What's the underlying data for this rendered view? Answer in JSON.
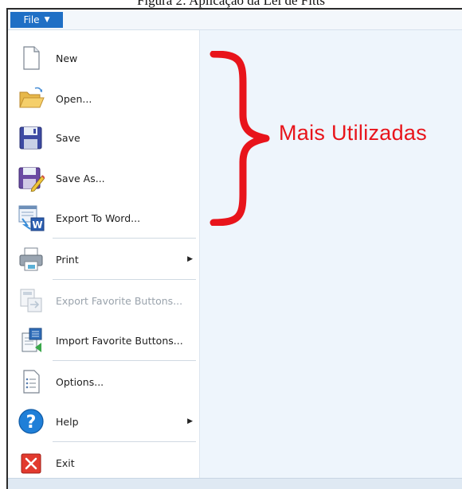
{
  "caption": "Figura 2: Aplicação da Lei de Fitts",
  "file_menu": {
    "label": "File"
  },
  "menu": {
    "items": [
      {
        "label": "New",
        "icon": "new-document-icon"
      },
      {
        "label": "Open...",
        "icon": "open-folder-icon"
      },
      {
        "label": "Save",
        "icon": "save-floppy-icon"
      },
      {
        "label": "Save As...",
        "icon": "save-as-icon"
      },
      {
        "label": "Export To Word...",
        "icon": "export-to-word-icon"
      },
      {
        "label": "Print",
        "icon": "printer-icon",
        "submenu": true
      },
      {
        "label": "Export Favorite Buttons...",
        "icon": "export-favorites-icon",
        "disabled": true
      },
      {
        "label": "Import Favorite Buttons...",
        "icon": "import-favorites-icon"
      },
      {
        "label": "Options...",
        "icon": "options-icon"
      },
      {
        "label": "Help",
        "icon": "help-icon",
        "submenu": true
      },
      {
        "label": "Exit",
        "icon": "exit-icon"
      }
    ]
  },
  "annotation": {
    "text": "Mais Utilizadas",
    "color": "#e8141b"
  },
  "colors": {
    "file_button": "#1f6fc5",
    "window_bg": "#eef5fc",
    "accent_red": "#e8141b"
  }
}
